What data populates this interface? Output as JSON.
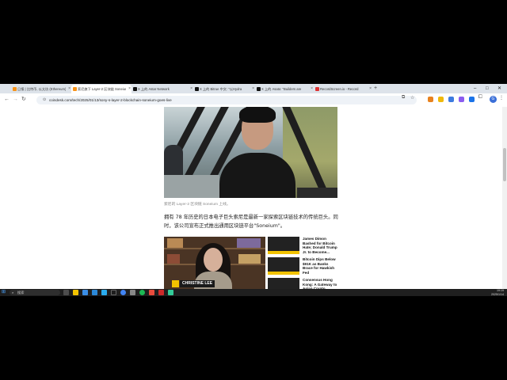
{
  "browser": {
    "tabs": [
      {
        "label": "日报 | 比特币, 以太坊 (Ethereum) 和Crypto",
        "active": false
      },
      {
        "label": "索尼旗下 Layer-2 区块链 Soneium",
        "active": true
      },
      {
        "label": "X 上的 Astar Network",
        "active": false
      },
      {
        "label": "X 上的 Bitrue 中文: \"以Hydra",
        "active": false
      },
      {
        "label": "X 上的 Asato: \"Builders are",
        "active": false
      },
      {
        "label": "RecordScreen.io - Record",
        "active": false
      }
    ],
    "new_tab_label": "+",
    "url": "coindesk.com/tech/2025/01/13/sony-s-layer-2-blockchain-soneium-goes-live",
    "avatar_initial": "G",
    "window_controls": [
      "–",
      "□",
      "✕"
    ]
  },
  "article": {
    "caption": "索尼的 Layer-2 区块链 Soneium 上线。",
    "paragraph": "拥有 78 年历史的日本电子巨头索尼是最新一家探索区块链技术的传统巨头。同时，该公司宣布正式推出通用区块链平台\"Soneium\"。",
    "video": {
      "host_name": "CHRISTINE LEE"
    },
    "related": [
      {
        "title": "James Dimon Bashed for Bitcoin Hate; Donald Trump Jr. to Become..."
      },
      {
        "title": "Bitcoin Dips Below $91K as Banks Brace for Hawkish Fed"
      },
      {
        "title": "Consensus Hong Kong: A Gateway to Asian Crypto..."
      }
    ]
  },
  "taskbar": {
    "search_placeholder": "搜索",
    "time": "19:19",
    "date": "2025/1/14"
  }
}
